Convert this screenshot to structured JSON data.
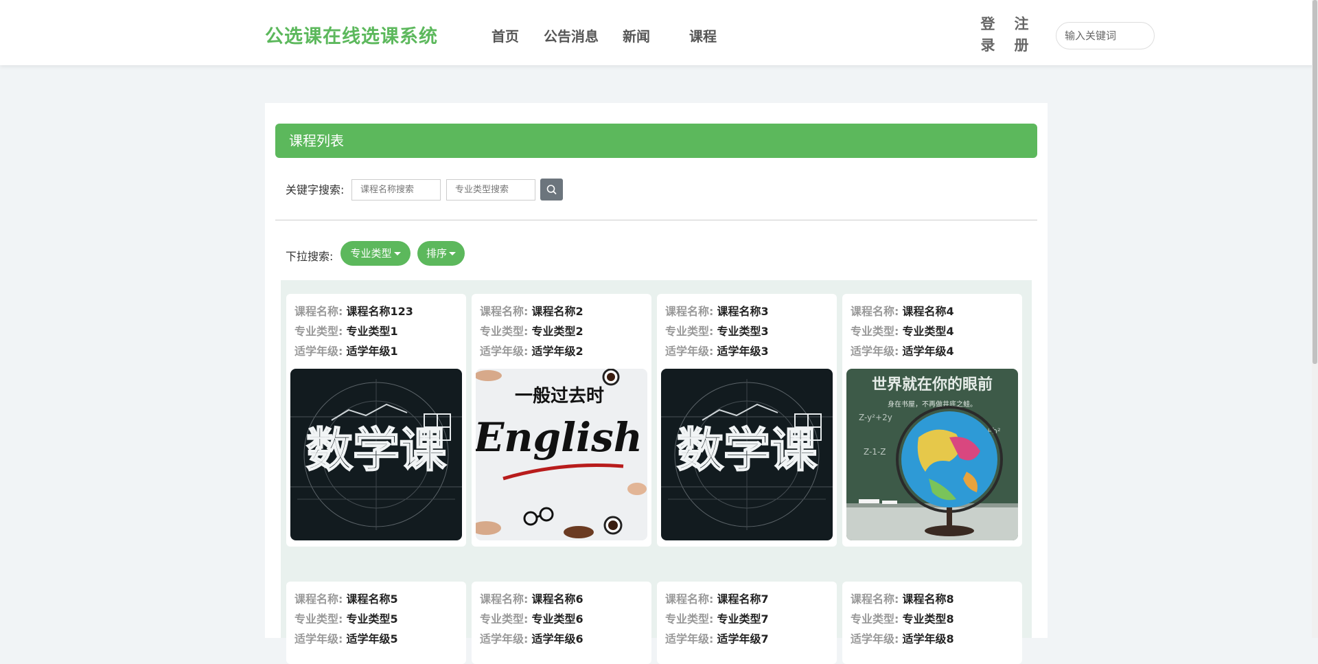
{
  "header": {
    "brand": "公选课在线选课系统",
    "nav": [
      "首页",
      "公告消息",
      "新闻",
      "课程"
    ],
    "login": "登录",
    "register": "注册",
    "search_placeholder": "输入关键词"
  },
  "panel": {
    "title": "课程列表",
    "keyword_label": "关键字搜索:",
    "name_placeholder": "课程名称搜索",
    "type_placeholder": "专业类型搜索",
    "dropdown_label": "下拉搜索:",
    "type_dropdown": "专业类型",
    "sort_dropdown": "排序"
  },
  "card_labels": {
    "name": "课程名称:",
    "type": "专业类型:",
    "grade": "适学年级:"
  },
  "courses": [
    {
      "name": "课程名称123",
      "type": "专业类型1",
      "grade": "适学年级1",
      "image": "math"
    },
    {
      "name": "课程名称2",
      "type": "专业类型2",
      "grade": "适学年级2",
      "image": "english"
    },
    {
      "name": "课程名称3",
      "type": "专业类型3",
      "grade": "适学年级3",
      "image": "math"
    },
    {
      "name": "课程名称4",
      "type": "专业类型4",
      "grade": "适学年级4",
      "image": "globe"
    },
    {
      "name": "课程名称5",
      "type": "专业类型5",
      "grade": "适学年级5"
    },
    {
      "name": "课程名称6",
      "type": "专业类型6",
      "grade": "适学年级6"
    },
    {
      "name": "课程名称7",
      "type": "专业类型7",
      "grade": "适学年级7"
    },
    {
      "name": "课程名称8",
      "type": "专业类型8",
      "grade": "适学年级8"
    }
  ],
  "image_text": {
    "math": "数学课",
    "english_title": "一般过去时",
    "english_word": "English",
    "globe_title": "世界就在你的眼前",
    "globe_subtitle": "身在书屋，不再做井底之蛙。"
  },
  "colors": {
    "accent": "#5cb85c",
    "search_button": "#6c757d",
    "grid_background": "#e9f1ee",
    "math_board": "#121b1f",
    "chalkboard": "#3d5a48"
  }
}
